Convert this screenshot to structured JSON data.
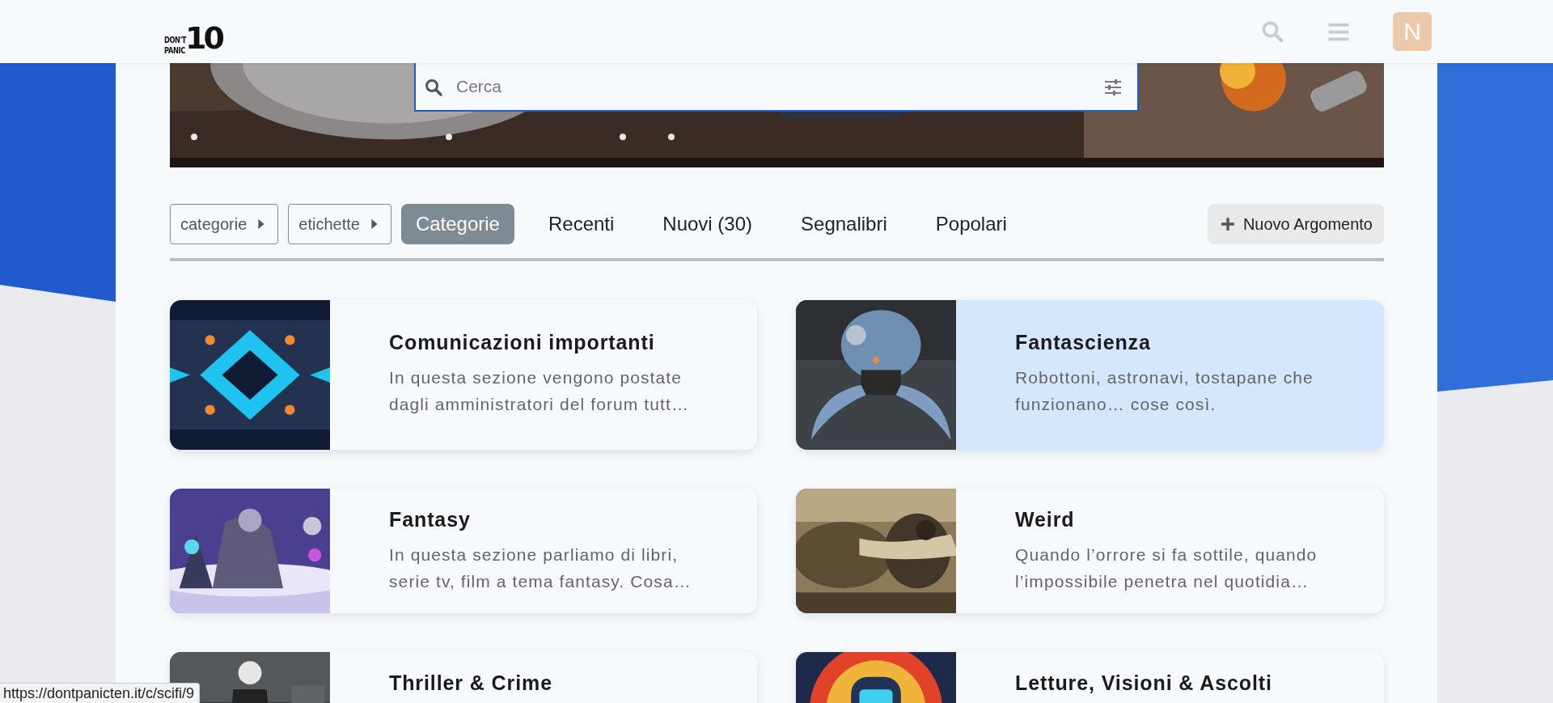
{
  "header": {
    "logo": {
      "line_1": "DON'T",
      "line_2": "PANIC",
      "number": "10"
    },
    "avatar": "N"
  },
  "search": {
    "placeholder": "Cerca"
  },
  "nav": {
    "dropdowns": [
      "categorie",
      "etichette"
    ],
    "tabs": [
      {
        "label": "Categorie",
        "selected": true
      },
      {
        "label": "Recenti",
        "selected": false
      },
      {
        "label": "Nuovi (30)",
        "selected": false
      },
      {
        "label": "Segnalibri",
        "selected": false
      },
      {
        "label": "Popolari",
        "selected": false
      }
    ],
    "new_topic_button": "Nuovo Argomento"
  },
  "categories": [
    {
      "title": "Comunicazioni importanti",
      "description": "In questa sezione vengono postate dagli amministratori del forum tutt…",
      "highlighted": false
    },
    {
      "title": "Fantascienza",
      "description": "Robottoni, astronavi, tostapane che funzionano… cose così.",
      "highlighted": true
    },
    {
      "title": "Fantasy",
      "description": "In questa sezione parliamo di libri, serie tv, film a tema fantasy. Cosa…",
      "highlighted": false
    },
    {
      "title": "Weird",
      "description": "Quando l’orrore si fa sottile, quando l’impossibile penetra nel quotidia…",
      "highlighted": false
    },
    {
      "title": "Thriller & Crime",
      "highlighted": false
    },
    {
      "title": "Letture, Visioni & Ascolti",
      "highlighted": false
    }
  ],
  "status_bar": {
    "url": "https://dontpanicten.it/c/scifi/9"
  }
}
